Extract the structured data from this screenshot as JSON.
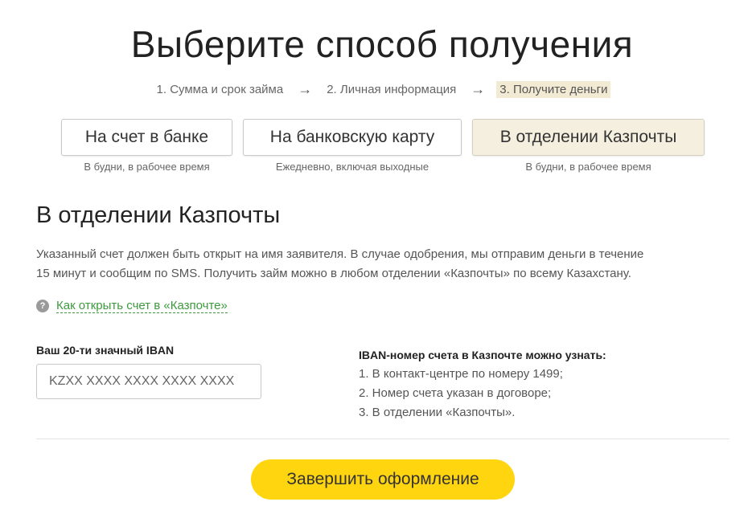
{
  "header": {
    "title": "Выберите способ получения"
  },
  "steps": [
    {
      "label": "1. Сумма и срок займа",
      "active": false
    },
    {
      "label": "2. Личная информация",
      "active": false
    },
    {
      "label": "3. Получите деньги",
      "active": true
    }
  ],
  "step_separator": "→",
  "methods": [
    {
      "label": "На счет в банке",
      "note": "В будни, в рабочее время",
      "selected": false
    },
    {
      "label": "На банковскую карту",
      "note": "Ежедневно, включая выходные",
      "selected": false
    },
    {
      "label": "В отделении Казпочты",
      "note": "В будни, в рабочее время",
      "selected": true
    }
  ],
  "section": {
    "title": "В отделении Казпочты",
    "description_line1": "Указанный счет должен быть открыт на имя заявителя. В случае одобрения, мы отправим деньги в течение",
    "description_line2": "15 минут и сообщим по SMS. Получить займ можно в любом отделении «Казпочты» по всему Казахстану.",
    "help_icon": "?",
    "help_link": "Как открыть счет в «Казпочте»"
  },
  "iban": {
    "label": "Ваш 20-ти значный IBAN",
    "placeholder": "KZXX XXXX XXXX XXXX XXXX",
    "value": ""
  },
  "info": {
    "title": "IBAN-номер счета в Казпочте можно узнать:",
    "items": [
      "1. В контакт-центре по номеру 1499;",
      "2. Номер счета указан в договоре;",
      "3. В отделении «Казпочты»."
    ]
  },
  "submit": {
    "label": "Завершить оформление"
  },
  "colors": {
    "accent_yellow": "#ffd50f",
    "selected_bg": "#f5efdf",
    "link_green": "#3c9a3c"
  }
}
